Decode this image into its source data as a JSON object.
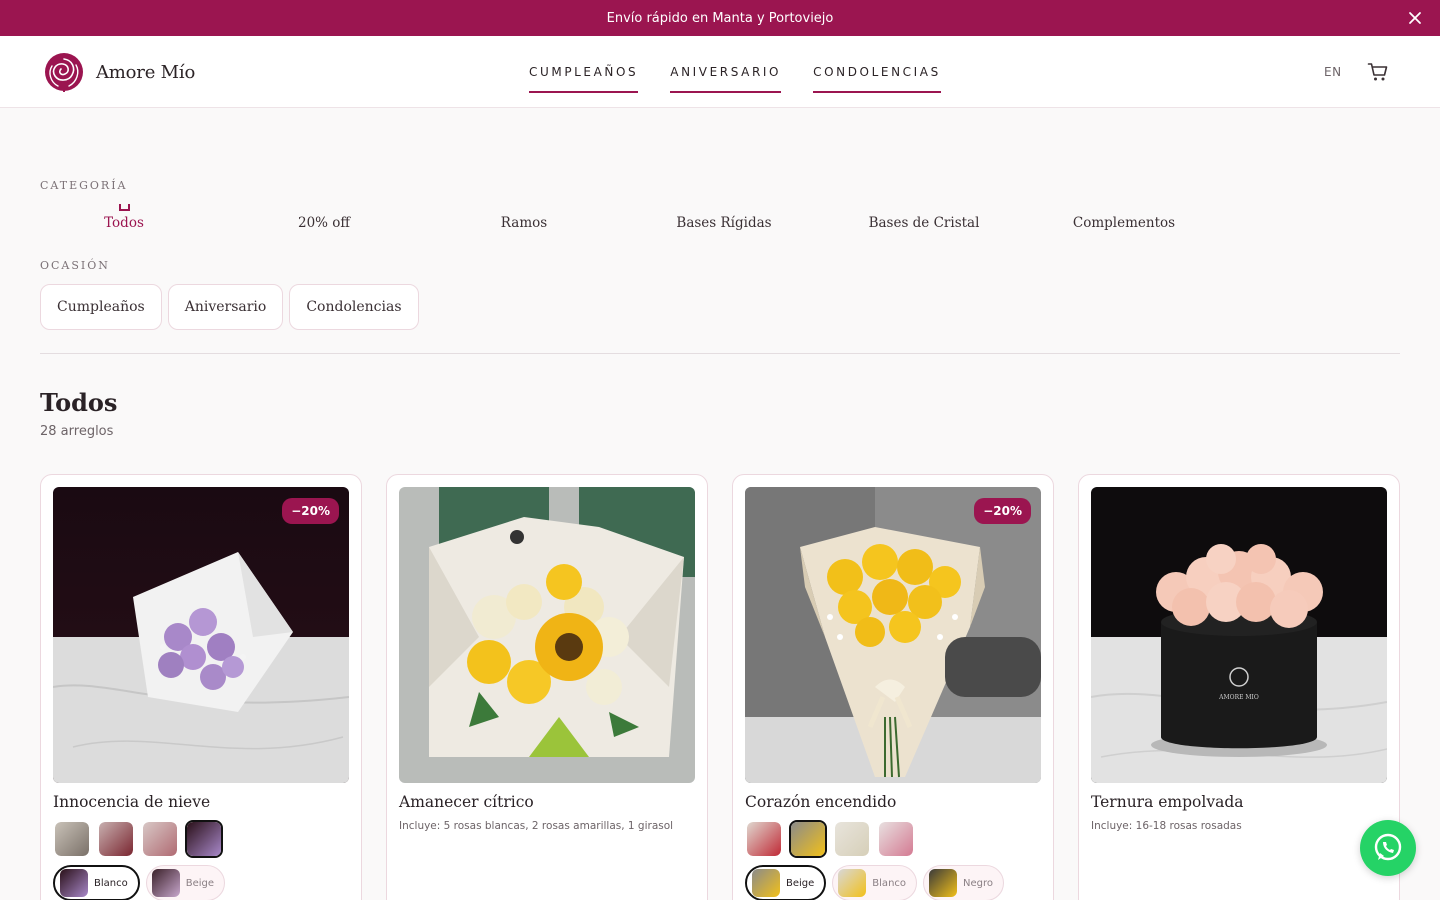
{
  "promo": {
    "text": "Envío rápido en Manta y Portoviejo"
  },
  "brand": {
    "name": "Amore Mío",
    "accent": "#9b1550"
  },
  "nav": {
    "items": [
      "CUMPLEAÑOS",
      "ANIVERSARIO",
      "CONDOLENCIAS"
    ]
  },
  "header": {
    "lang": "EN"
  },
  "filters": {
    "category_label": "CATEGORÍA",
    "categories": [
      "Todos",
      "20% off",
      "Ramos",
      "Bases Rígidas",
      "Bases de Cristal",
      "Complementos"
    ],
    "active_category": "Todos",
    "occasion_label": "OCASIÓN",
    "occasions": [
      "Cumpleaños",
      "Aniversario",
      "Condolencias"
    ]
  },
  "listing": {
    "title": "Todos",
    "count": "28 arreglos"
  },
  "products": [
    {
      "name": "Innocencia de nieve",
      "badge": "−20%",
      "thumbs": 4,
      "selected_thumb": 4,
      "colors": [
        "Blanco",
        "Beige"
      ],
      "selected_color": "Blanco"
    },
    {
      "name": "Amanecer cítrico",
      "description": "Incluye: 5 rosas blancas, 2 rosas amarillas, 1 girasol"
    },
    {
      "name": "Corazón encendido",
      "badge": "−20%",
      "thumbs": 4,
      "selected_thumb": 2,
      "colors": [
        "Beige",
        "Blanco",
        "Negro"
      ],
      "selected_color": "Beige"
    },
    {
      "name": "Ternura empolvada",
      "description": "Incluye: 16-18 rosas rosadas"
    }
  ]
}
